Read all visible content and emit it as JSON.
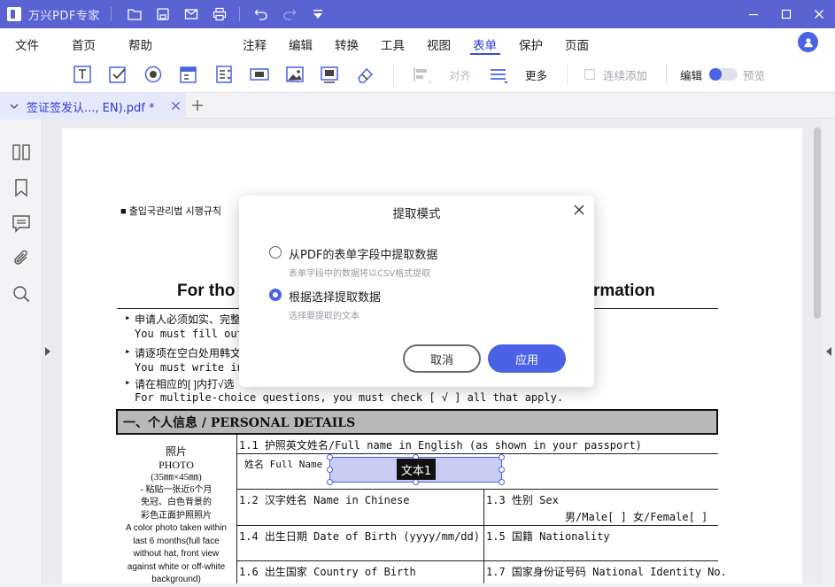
{
  "app": {
    "title": "万兴PDF专家"
  },
  "menu": {
    "left": [
      "文件",
      "首页",
      "帮助"
    ],
    "tabs": [
      "注释",
      "编辑",
      "转换",
      "工具",
      "视图",
      "表单",
      "保护",
      "页面"
    ],
    "active_tab": "表单"
  },
  "toolbar": {
    "align_label": "对齐",
    "more_label": "更多",
    "continuous_add_label": "连续添加",
    "edit_label": "编辑",
    "preview_label": "预览"
  },
  "document_tab": {
    "label": "签证签发认..., EN).pdf *"
  },
  "pdf": {
    "header_korean": "■ 출입국관리법 시행규칙",
    "heading_left": "For tho",
    "heading_right": "rmation",
    "line1_cn": "申请人必须如实、完整、",
    "line1_en": "You must fill out thi",
    "line2_cn": "请逐项在空白处用韩文",
    "line2_en": "You must write in blo",
    "line3_cn": "请在相应的[ ]内打√选",
    "line3_en": "For multiple-choice questions, you must check [ √ ] all that apply.",
    "section_title": "一、个人信息 / PERSONAL DETAILS",
    "photo": {
      "line1": "照片",
      "line2": "PHOTO",
      "line3": "(35㎜×45㎜)",
      "line4": "- 粘贴一张近6个月",
      "line5": "免冠、白色背景的",
      "line6": "彩色正面护照照片",
      "line7": "A color photo taken within",
      "line8": "last 6 months(full face",
      "line9": "without hat, front view",
      "line10": "against white or off-white",
      "line11": "background)"
    },
    "f11": "1.1 护照英文姓名/Full name in English (as shown in your passport)",
    "f11_sub": "姓名 Full Name",
    "field_tag": "文本1",
    "f12": "1.2 汉字姓名 Name in Chinese",
    "f13": "1.3 性别 Sex",
    "f13_options": "男/Male[   ]  女/Female[   ]",
    "f14": "1.4 出生日期 Date of Birth (yyyy/mm/dd)",
    "f15": "1.5 国籍 Nationality",
    "f16": "1.6 出生国家 Country of Birth",
    "f17": "1.7 国家身份证号码 National Identity No."
  },
  "dialog": {
    "title": "提取模式",
    "option1_label": "从PDF的表单字段中提取数据",
    "option1_desc": "表单字段中的数据将以CSV格式提取",
    "option2_label": "根据选择提取数据",
    "option2_desc": "选择要提取的文本",
    "selected_option": 2,
    "cancel_label": "取消",
    "apply_label": "应用"
  },
  "colors": {
    "accent": "#4a63e6",
    "titlebar": "#5b63d3"
  }
}
